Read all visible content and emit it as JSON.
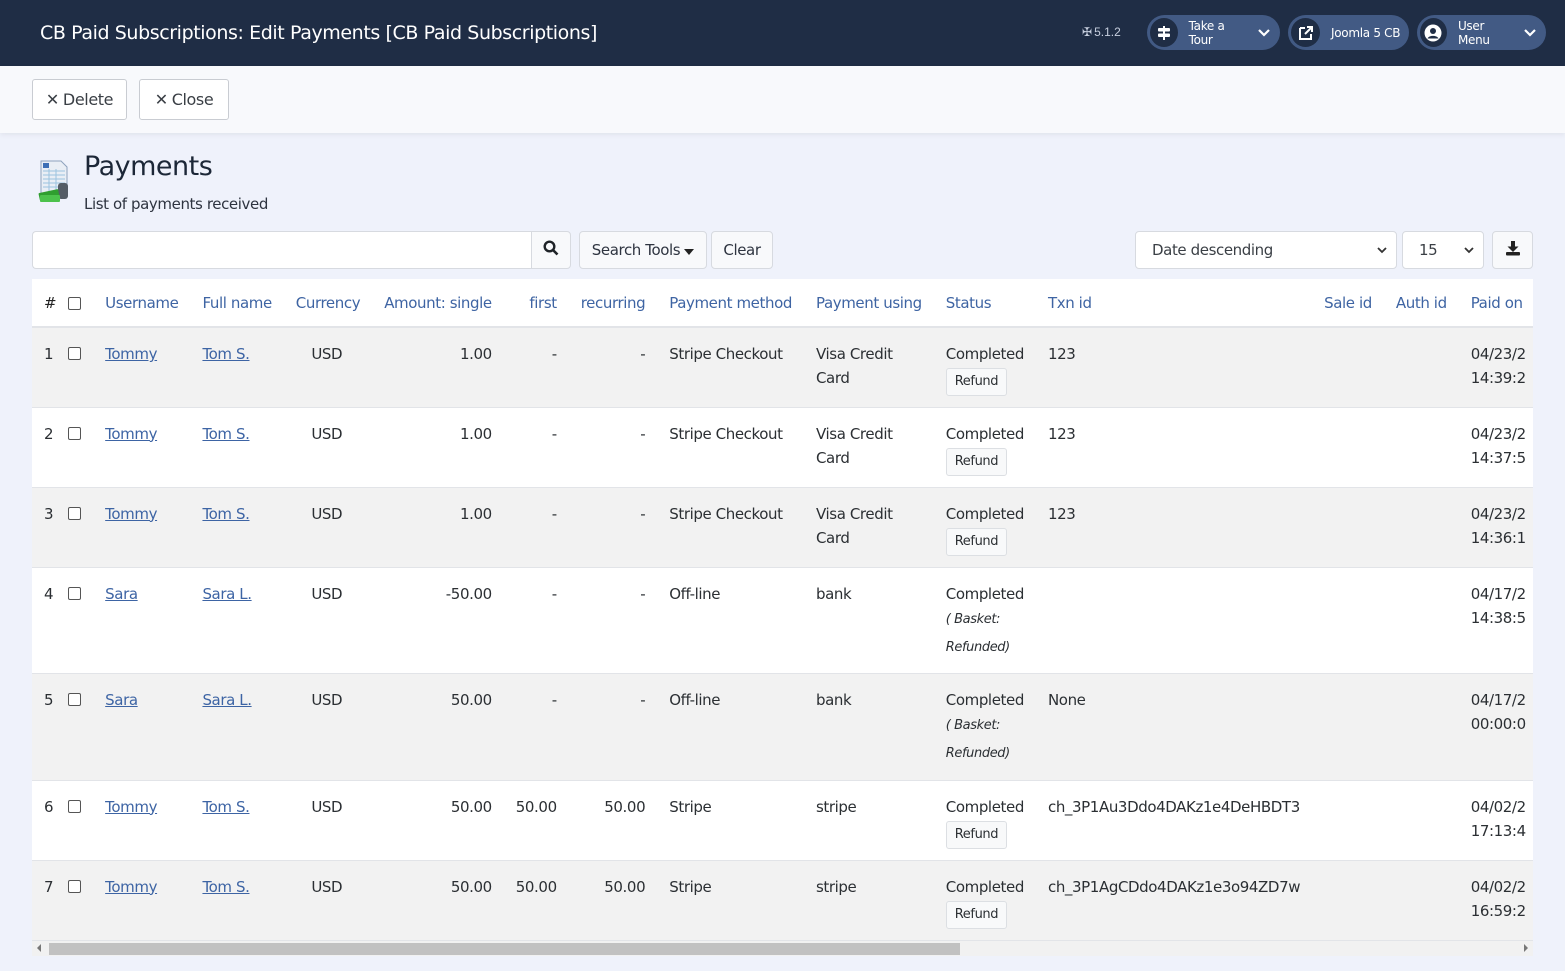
{
  "header": {
    "title": "CB Paid Subscriptions: Edit Payments [CB Paid Subscriptions]",
    "version": "5.1.2",
    "buttons": {
      "tour": "Take a Tour",
      "site": "Joomla 5 CB",
      "user": "User Menu"
    }
  },
  "toolbar": {
    "delete_label": "Delete",
    "close_label": "Close"
  },
  "page": {
    "title": "Payments",
    "subtitle": "List of payments received"
  },
  "filters": {
    "search_value": "",
    "search_placeholder": "",
    "search_tools_label": "Search Tools",
    "clear_label": "Clear",
    "ordering_selected": "Date descending",
    "limit_selected": "15"
  },
  "table": {
    "columns": [
      "#",
      "",
      "Username",
      "Full name",
      "Currency",
      "Amount: single",
      "first",
      "recurring",
      "Payment method",
      "Payment using",
      "Status",
      "Txn id",
      "Sale id",
      "Auth id",
      "Paid on"
    ],
    "refund_label": "Refund",
    "rows": [
      {
        "num": "1",
        "username": "Tommy",
        "fullname": "Tom S.",
        "currency": "USD",
        "single": "1.00",
        "first": "-",
        "recurring": "-",
        "method": "Stripe Checkout",
        "using": "Visa Credit Card",
        "status": "Completed",
        "refund": true,
        "basket": "",
        "txn": "123",
        "sale": "",
        "auth": "",
        "paid_date": "04/23/2",
        "paid_time": "14:39:2"
      },
      {
        "num": "2",
        "username": "Tommy",
        "fullname": "Tom S.",
        "currency": "USD",
        "single": "1.00",
        "first": "-",
        "recurring": "-",
        "method": "Stripe Checkout",
        "using": "Visa Credit Card",
        "status": "Completed",
        "refund": true,
        "basket": "",
        "txn": "123",
        "sale": "",
        "auth": "",
        "paid_date": "04/23/2",
        "paid_time": "14:37:5"
      },
      {
        "num": "3",
        "username": "Tommy",
        "fullname": "Tom S.",
        "currency": "USD",
        "single": "1.00",
        "first": "-",
        "recurring": "-",
        "method": "Stripe Checkout",
        "using": "Visa Credit Card",
        "status": "Completed",
        "refund": true,
        "basket": "",
        "txn": "123",
        "sale": "",
        "auth": "",
        "paid_date": "04/23/2",
        "paid_time": "14:36:1"
      },
      {
        "num": "4",
        "username": "Sara",
        "fullname": "Sara L.",
        "currency": "USD",
        "single": "-50.00",
        "first": "-",
        "recurring": "-",
        "method": "Off-line",
        "using": "bank",
        "status": "Completed",
        "refund": false,
        "basket": "( Basket: Refunded)",
        "txn": "",
        "sale": "",
        "auth": "",
        "paid_date": "04/17/2",
        "paid_time": "14:38:5"
      },
      {
        "num": "5",
        "username": "Sara",
        "fullname": "Sara L.",
        "currency": "USD",
        "single": "50.00",
        "first": "-",
        "recurring": "-",
        "method": "Off-line",
        "using": "bank",
        "status": "Completed",
        "refund": false,
        "basket": "( Basket: Refunded)",
        "txn": "None",
        "sale": "",
        "auth": "",
        "paid_date": "04/17/2",
        "paid_time": "00:00:0"
      },
      {
        "num": "6",
        "username": "Tommy",
        "fullname": "Tom S.",
        "currency": "USD",
        "single": "50.00",
        "first": "50.00",
        "recurring": "50.00",
        "method": "Stripe",
        "using": "stripe",
        "status": "Completed",
        "refund": true,
        "basket": "",
        "txn": "ch_3P1Au3Ddo4DAKz1e4DeHBDT3",
        "sale": "",
        "auth": "",
        "paid_date": "04/02/2",
        "paid_time": "17:13:4"
      },
      {
        "num": "7",
        "username": "Tommy",
        "fullname": "Tom S.",
        "currency": "USD",
        "single": "50.00",
        "first": "50.00",
        "recurring": "50.00",
        "method": "Stripe",
        "using": "stripe",
        "status": "Completed",
        "refund": true,
        "basket": "",
        "txn": "ch_3P1AgCDdo4DAKz1e3o94ZD7w",
        "sale": "",
        "auth": "",
        "paid_date": "04/02/2",
        "paid_time": "16:59:2"
      }
    ]
  },
  "colors": {
    "header_bg": "#1f2d45",
    "pill_bg": "#425a84",
    "link": "#3d64a4",
    "page_bg": "#eff2fb"
  }
}
